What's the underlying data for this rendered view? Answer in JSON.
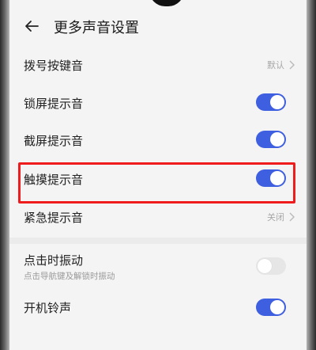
{
  "header": {
    "title": "更多声音设置"
  },
  "settings": [
    {
      "label": "拨号按键音",
      "value": "默认"
    },
    {
      "label": "锁屏提示音",
      "enabled": true
    },
    {
      "label": "截屏提示音",
      "enabled": true
    },
    {
      "label": "触摸提示音",
      "enabled": true
    },
    {
      "label": "紧急提示音",
      "value": "关闭"
    },
    {
      "label": "点击时振动",
      "sublabel": "点击导航键及解锁时振动",
      "enabled": false
    },
    {
      "label": "开机铃声",
      "enabled": true
    }
  ],
  "colors": {
    "toggle_on": "#3d5fe0",
    "highlight_border": "#ee1c1c"
  },
  "icons": {
    "back": "back-arrow-icon",
    "chevron": "chevron-right-icon"
  }
}
